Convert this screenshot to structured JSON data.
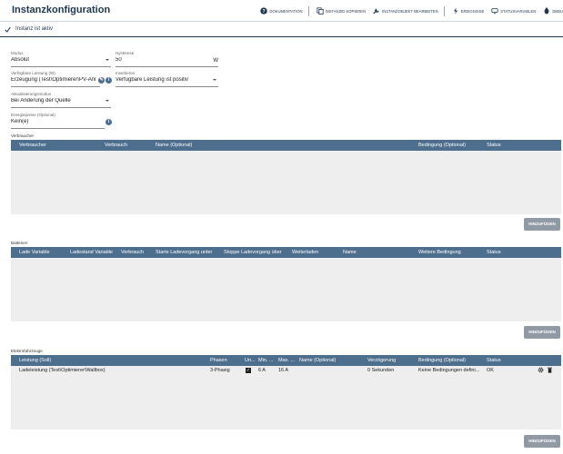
{
  "header": {
    "title": "Instanzkonfiguration",
    "toolbar": [
      {
        "label": "DOKUMENTATION",
        "icon": "help-circle-icon"
      },
      {
        "label": "INSTANZID KOPIEREN",
        "icon": "copy-icon"
      },
      {
        "label": "INSTANZOBJEKT BEARBEITEN",
        "icon": "wrench-icon"
      },
      {
        "label": "EREIGNISSE",
        "icon": "lightning-icon"
      },
      {
        "label": "STATUSVARIABLEN",
        "icon": "monitor-icon"
      },
      {
        "label": "DEBU",
        "icon": "bug-icon"
      }
    ]
  },
  "status": {
    "active_label": "Instanz ist aktiv"
  },
  "form": {
    "modus": {
      "label": "Modus",
      "value": "Absolut"
    },
    "hysterese": {
      "label": "Hysterese",
      "value": "50",
      "unit": "W"
    },
    "leistung": {
      "label": "Verfügbare Leistung (W)",
      "value": "Erzeugung (Test\\Optimierer\\PV-Anl"
    },
    "invertieren": {
      "label": "Invertieren",
      "value": "Verfügbare Leistung ist positiv"
    },
    "aktualisierung": {
      "label": "Aktualisierungsmodus",
      "value": "Bei Änderung der Quelle"
    },
    "energiepreise": {
      "label": "Energiepreise (Optional)",
      "value": "Kein(e)"
    }
  },
  "verbraucher": {
    "title": "Verbraucher",
    "columns": [
      "Verbraucher",
      "Verbrauch",
      "Name (Optional)",
      "Bedingung (Optional)",
      "Status"
    ],
    "add_label": "HINZUFÜGEN"
  },
  "batterien": {
    "title": "Batterien",
    "columns": [
      "Lade Variable",
      "Ladestand Variable",
      "Verbrauch",
      "Starte Ladevorgang unter",
      "Stoppe Ladevorgang über",
      "Weiterladen",
      "Name",
      "Weitere Bedingung",
      "Status"
    ],
    "add_label": "HINZUFÜGEN"
  },
  "elektro": {
    "title": "Elektrofahrzeuge",
    "columns": [
      "Leistung (Soll)",
      "Phasen",
      "Un...",
      "Min. ...",
      "Max. ...",
      "Name (Optional)",
      "Verzögerung",
      "Bedingung (Optional)",
      "Status"
    ],
    "rows": [
      {
        "leistung": "Ladeleistung (Test\\Optimierer\\Wallbox)",
        "phasen": "3-Phasig",
        "un": true,
        "min": "6 A",
        "max": "16 A",
        "name": "",
        "verzoegerung": "0 Sekunden",
        "bedingung": "Keine Bedingungen defini...",
        "status": "OK"
      }
    ],
    "add_label": "HINZUFÜGEN"
  },
  "colors": {
    "accent": "#1f3650",
    "table_header": "#4e6e8e",
    "button": "#8f9aa5"
  }
}
